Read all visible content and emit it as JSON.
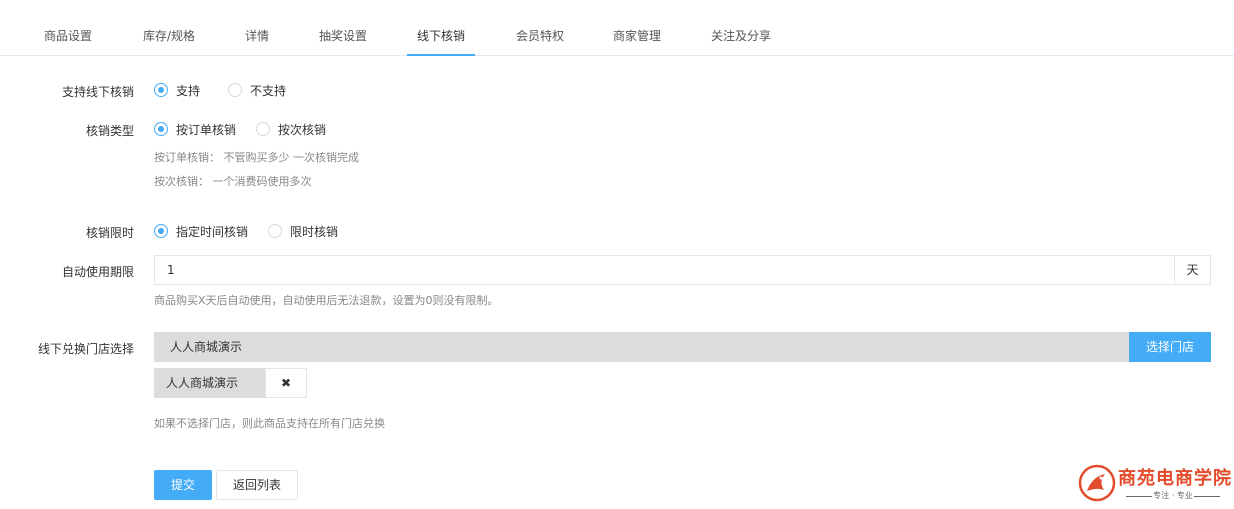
{
  "tabs": [
    {
      "label": "商品设置"
    },
    {
      "label": "库存/规格"
    },
    {
      "label": "详情"
    },
    {
      "label": "抽奖设置"
    },
    {
      "label": "线下核销"
    },
    {
      "label": "会员特权"
    },
    {
      "label": "商家管理"
    },
    {
      "label": "关注及分享"
    }
  ],
  "active_tab": "线下核销",
  "support": {
    "label": "支持线下核销",
    "options": [
      "支持",
      "不支持"
    ],
    "selected": "支持"
  },
  "verify_type": {
    "label": "核销类型",
    "options": [
      "按订单核销",
      "按次核销"
    ],
    "selected": "按订单核销",
    "help1": "按订单核销： 不管购买多少 一次核销完成",
    "help2": "按次核销： 一个消费码使用多次"
  },
  "verify_limit": {
    "label": "核销限时",
    "options": [
      "指定时间核销",
      "限时核销"
    ],
    "selected": "指定时间核销"
  },
  "auto_use": {
    "label": "自动使用期限",
    "value": "1",
    "addon": "天",
    "help": "商品购买X天后自动使用，自动使用后无法退款，设置为0则没有限制。"
  },
  "store": {
    "label": "线下兑换门店选择",
    "selected_display": "人人商城演示",
    "select_button": "选择门店",
    "chip": "人人商城演示",
    "remove_icon": "✖",
    "help": "如果不选择门店，则此商品支持在所有门店兑换"
  },
  "actions": {
    "submit": "提交",
    "back": "返回列表"
  },
  "logo": {
    "text": "商苑电商学院",
    "slogan": "专注 · 专业"
  },
  "colors": {
    "accent": "#44abf7",
    "logo": "#e24c2a"
  }
}
